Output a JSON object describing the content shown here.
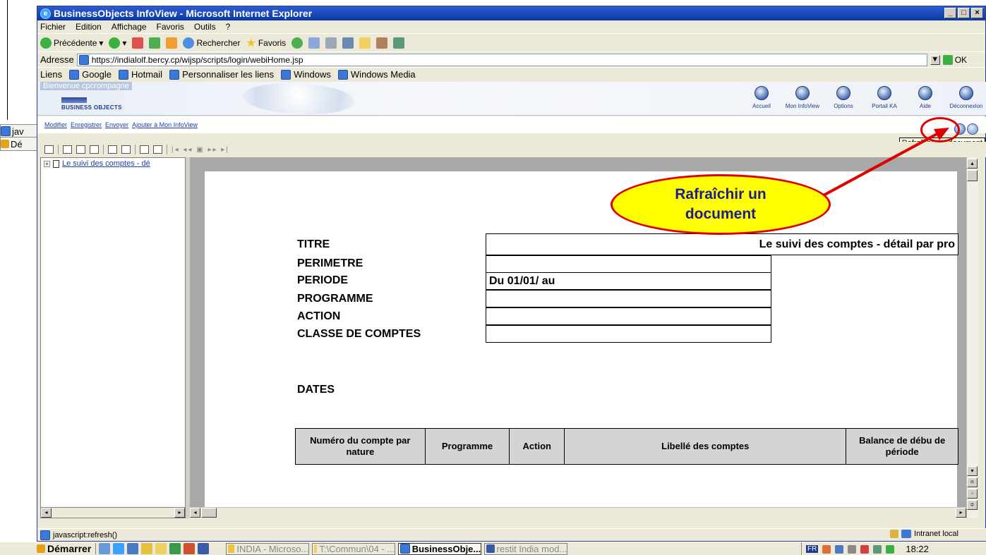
{
  "desktop": {
    "items": [
      {
        "label": "jav"
      },
      {
        "label": "Dé"
      }
    ]
  },
  "window": {
    "title": "BusinessObjects InfoView - Microsoft Internet Explorer",
    "menu": [
      "Fichier",
      "Edition",
      "Affichage",
      "Favoris",
      "Outils",
      "?"
    ],
    "toolbar": {
      "back": "Précédente",
      "search": "Rechercher",
      "favorites": "Favoris"
    },
    "address": {
      "label": "Adresse",
      "url": "https://indialolf.bercy.cp/wijsp/scripts/login/webiHome.jsp",
      "go": "OK"
    },
    "links": {
      "label": "Liens",
      "items": [
        "Google",
        "Hotmail",
        "Personnaliser les liens",
        "Windows",
        "Windows Media"
      ]
    }
  },
  "bo": {
    "welcome": "Bienvenue cpcrompagne",
    "logo": "BUSINESS OBJECTS",
    "nav": [
      "Accueil",
      "Mon InfoView",
      "Options",
      "Portail KA",
      "Aide",
      "Déconnexion"
    ],
    "actions": [
      "Modifier",
      "Enregistrer",
      "Envoyer",
      "Ajouter à Mon InfoView"
    ],
    "tooltip": "Rafraîchir un document"
  },
  "tree": {
    "item": "Le suivi des comptes - dé"
  },
  "report": {
    "labels": {
      "titre": "TITRE",
      "perimetre": "PERIMETRE",
      "periode": "PERIODE",
      "programme": "PROGRAMME",
      "action": "ACTION",
      "classe": "CLASSE DE COMPTES",
      "dates": "DATES"
    },
    "values": {
      "titre": "Le suivi des comptes - détail par pro",
      "periode": "Du 01/01/ au"
    },
    "columns": [
      "Numéro du compte par nature",
      "Programme",
      "Action",
      "Libellé des comptes",
      "Balance de débu de période"
    ]
  },
  "callout": {
    "text": "Rafraîchir un document"
  },
  "status": {
    "text": "javascript:refresh()",
    "zone": "Intranet local"
  },
  "taskbar": {
    "start": "Démarrer",
    "tasks": [
      {
        "label": "INDIA - Microso..."
      },
      {
        "label": "T:\\Commun\\04 - ..."
      },
      {
        "label": "BusinessObje..."
      },
      {
        "label": "restit India mod..."
      }
    ],
    "lang": "FR",
    "time": "18:22"
  },
  "colors": {
    "titlebar": "#0a3aa7",
    "callout_fill": "#ffff00",
    "callout_border": "#e00000",
    "link": "#1c3fa8"
  }
}
